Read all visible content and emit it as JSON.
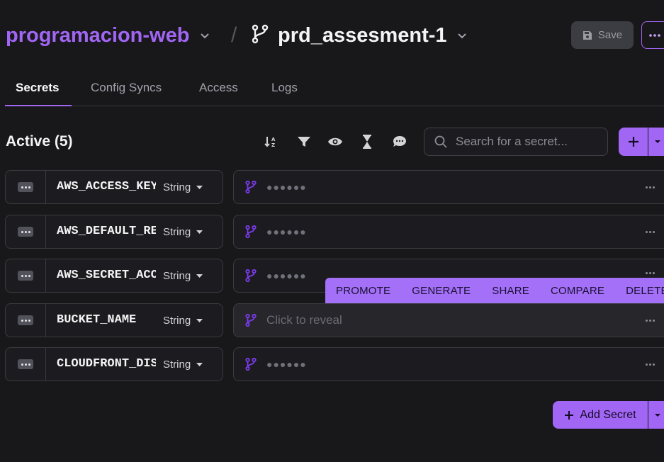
{
  "header": {
    "project": "programacion-web",
    "separator": "/",
    "branch": "prd_assesment-1",
    "save_label": "Save"
  },
  "tabs": [
    {
      "label": "Secrets",
      "active": true
    },
    {
      "label": "Config Syncs",
      "active": false
    },
    {
      "label": "Access",
      "active": false
    },
    {
      "label": "Logs",
      "active": false
    }
  ],
  "toolbar": {
    "title": "Active (5)",
    "icons": [
      "sort-icon",
      "filter-icon",
      "eye-icon",
      "hourglass-icon",
      "comment-icon"
    ],
    "search_placeholder": "Search for a secret..."
  },
  "secrets": [
    {
      "key": "AWS_ACCESS_KEY_ID",
      "type": "String",
      "value": "●●●●●●"
    },
    {
      "key": "AWS_DEFAULT_REGION",
      "type": "String",
      "value": "●●●●●●"
    },
    {
      "key": "AWS_SECRET_ACCESS_KEY",
      "type": "String",
      "value": "●●●●●●"
    },
    {
      "key": "BUCKET_NAME",
      "type": "String",
      "value": "Click to reveal"
    },
    {
      "key": "CLOUDFRONT_DISTRIBUTION_ID",
      "type": "String",
      "value": "●●●●●●"
    }
  ],
  "actions": [
    "PROMOTE",
    "GENERATE",
    "SHARE",
    "COMPARE",
    "DELETE"
  ],
  "add_secret_label": "Add Secret",
  "colors": {
    "accent": "#a266f5",
    "background": "#18181b",
    "branch_icon": "#7c3aed"
  }
}
